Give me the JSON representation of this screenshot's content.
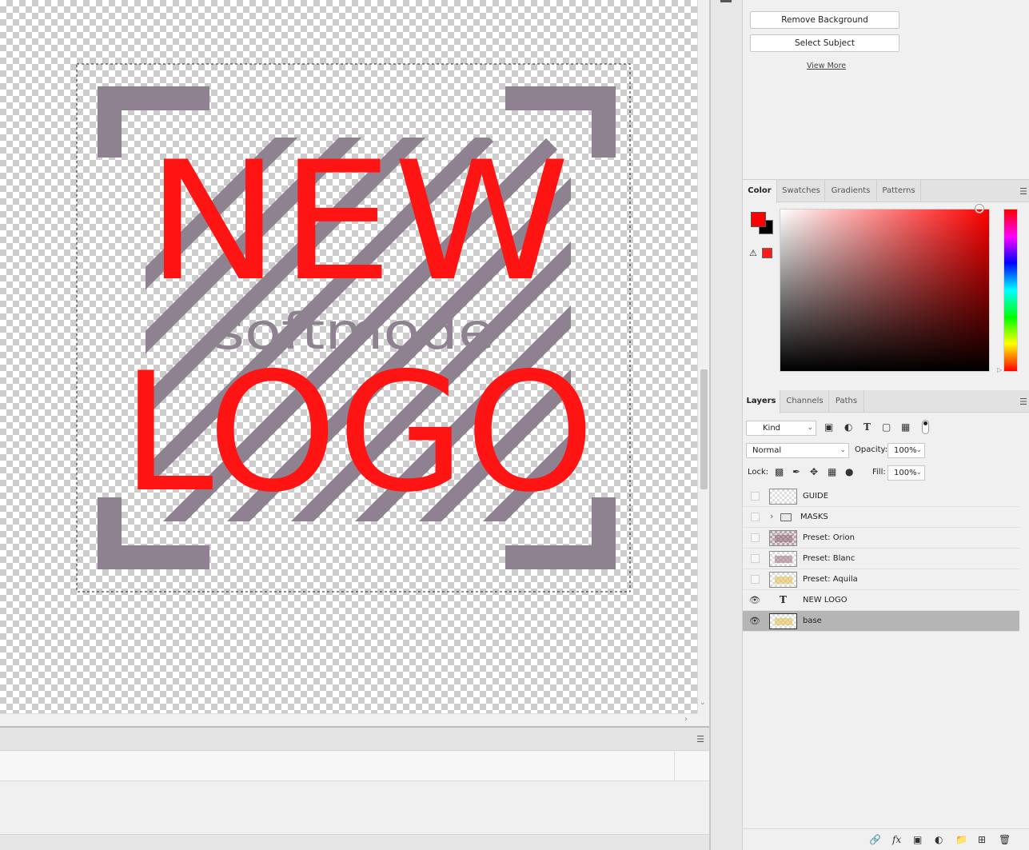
{
  "canvas": {
    "headline_top": "NEW",
    "headline_bottom": "LOGO",
    "subline": "softmode",
    "colors": {
      "headline": "#ff1414",
      "frame": "#8e8290",
      "checker": "#cccccc"
    }
  },
  "quick_actions": {
    "remove_background": "Remove Background",
    "select_subject": "Select Subject",
    "view_more": "View More"
  },
  "color_panel": {
    "tabs": [
      "Color",
      "Swatches",
      "Gradients",
      "Patterns"
    ],
    "active_tab": "Color",
    "foreground": "#ff0000",
    "background": "#000000"
  },
  "layers_panel": {
    "tabs": [
      "Layers",
      "Channels",
      "Paths"
    ],
    "active_tab": "Layers",
    "filter_kind": "Kind",
    "blend_mode": "Normal",
    "opacity_label": "Opacity:",
    "opacity": "100%",
    "lock_label": "Lock:",
    "fill_label": "Fill:",
    "fill": "100%",
    "layers": [
      {
        "name": "GUIDE",
        "type": "pixel",
        "visible": false
      },
      {
        "name": "MASKS",
        "type": "group",
        "visible": false
      },
      {
        "name": "Preset: Orion",
        "type": "pixel",
        "visible": false
      },
      {
        "name": "Preset: Blanc",
        "type": "pixel",
        "visible": false
      },
      {
        "name": "Preset: Aquila",
        "type": "pixel",
        "visible": false
      },
      {
        "name": "NEW LOGO",
        "type": "text",
        "visible": true
      },
      {
        "name": "base",
        "type": "pixel",
        "visible": true,
        "selected": true
      }
    ]
  }
}
